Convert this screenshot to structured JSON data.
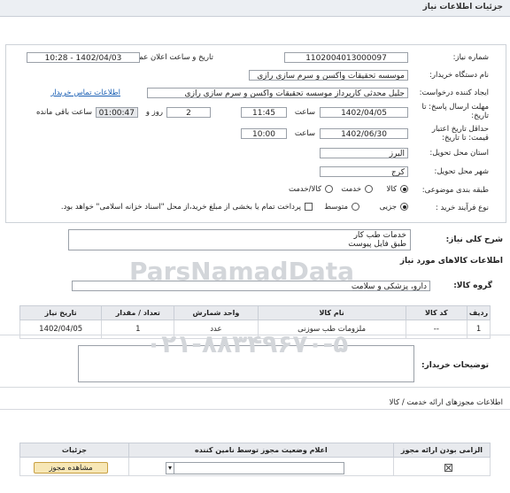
{
  "page": {
    "title": "جزئیات اطلاعات نیاز"
  },
  "need": {
    "number_label": "شماره نیاز:",
    "number": "1102004013000097",
    "announce_label": "تاریخ و ساعت اعلان عمومی:",
    "announce": "1402/04/03 - 10:28",
    "buyer_label": "نام دستگاه خریدار:",
    "buyer": "موسسه تحقیقات واکسن و سرم سازی رازی",
    "creator_label": "ایجاد کننده درخواست:",
    "creator": "جلیل محدثی کارپرداز موسسه تحقیقات واکسن و سرم سازی رازی",
    "contact_link": "اطلاعات تماس خریدار",
    "deadline_label": "مهلت ارسال پاسخ: تا تاریخ:",
    "deadline_date": "1402/04/05",
    "time_label": "ساعت",
    "deadline_time": "11:45",
    "days_value": "2",
    "days_label": "روز و",
    "remaining_time": "01:00:47",
    "remaining_label": "ساعت باقی مانده",
    "validity_label": "حداقل تاریخ اعتبار قیمت: تا تاریخ:",
    "validity_date": "1402/06/30",
    "validity_time_label": "ساعت",
    "validity_time": "10:00",
    "province_label": "استان محل تحویل:",
    "province": "البرز",
    "city_label": "شهر محل تحویل:",
    "city": "کرج",
    "category_label": "طبقه بندی موضوعی:",
    "category_options": [
      "کالا",
      "خدمت",
      "کالا/خدمت"
    ],
    "process_label": "نوع فرآیند خرید :",
    "process_options": [
      "جزیی",
      "متوسط"
    ],
    "payment_note": "پرداخت تمام یا بخشی از مبلغ خرید،از محل \"اسناد خزانه اسلامی\" خواهد بود."
  },
  "summary": {
    "label": "شرح کلی نیاز:",
    "lines": [
      "خدمات طب کار",
      "طبق فایل پیوست"
    ]
  },
  "goods": {
    "title": "اطلاعات کالاهای مورد نیاز",
    "group_label": "گروه کالا:",
    "group_value": "دارو، پزشکی و سلامت",
    "headers": [
      "ردیف",
      "کد کالا",
      "نام کالا",
      "واحد شمارش",
      "تعداد / مقدار",
      "تاریخ نیاز"
    ],
    "rows": [
      {
        "row": "1",
        "code": "--",
        "name": "ملزومات طب سوزنی",
        "unit": "عدد",
        "qty": "1",
        "date": "1402/04/05"
      }
    ]
  },
  "buyer_notes": {
    "label": "توضیحات خریدار:"
  },
  "licenses": {
    "title": "اطلاعات مجوزهای ارائه خدمت / کالا",
    "headers": [
      "الزامی بودن ارائه مجوز",
      "اعلام وضعیت مجوز توسط نامین کننده",
      "جزئیات"
    ],
    "view_button": "مشاهده مجوز"
  },
  "watermarks": {
    "brand": "ParsNamadData",
    "phone": "۰۲۱-۸۸۳۴۹۶۷۰-۵"
  },
  "colors": {
    "accent_link": "#1a5fb4",
    "button_bg": "#f7e7b6",
    "header_bg": "#e8eaee"
  }
}
